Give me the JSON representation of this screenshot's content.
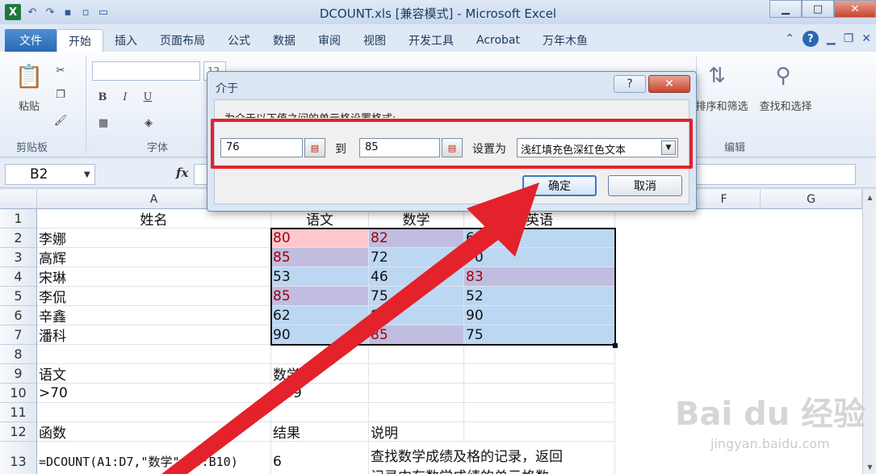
{
  "window": {
    "title": "DCOUNT.xls  [兼容模式]  -  Microsoft Excel",
    "minimize": "▁",
    "maximize": "□",
    "close": "✕"
  },
  "quick_access": {
    "logo": "X",
    "undo": "↶",
    "redo": "↷"
  },
  "ribbon_tabs": [
    {
      "label": "文件"
    },
    {
      "label": "开始"
    },
    {
      "label": "插入"
    },
    {
      "label": "页面布局"
    },
    {
      "label": "公式"
    },
    {
      "label": "数据"
    },
    {
      "label": "审阅"
    },
    {
      "label": "视图"
    },
    {
      "label": "开发工具"
    },
    {
      "label": "Acrobat"
    },
    {
      "label": "万年木鱼"
    }
  ],
  "ribbon": {
    "paste_label": "粘贴",
    "clipboard_label": "剪贴板",
    "font_label": "字体",
    "font_size": "12",
    "bold": "B",
    "italic": "I",
    "underline": "U",
    "sort_filter": "排序和筛选",
    "find_select": "查找和选择",
    "edit_label": "编辑"
  },
  "formula_bar": {
    "name_box": "B2",
    "fx": "fx"
  },
  "columns": [
    "A",
    "B",
    "C",
    "D",
    "E",
    "F",
    "G"
  ],
  "rows": [
    {
      "num": "1",
      "a": "姓名",
      "b": "语文",
      "c": "数学",
      "d": "英语"
    },
    {
      "num": "2",
      "a": "李娜",
      "b": "80",
      "c": "82",
      "d": "63"
    },
    {
      "num": "3",
      "a": "高辉",
      "b": "85",
      "c": "72",
      "d": "70"
    },
    {
      "num": "4",
      "a": "宋琳",
      "b": "53",
      "c": "46",
      "d": "83"
    },
    {
      "num": "5",
      "a": "李侃",
      "b": "85",
      "c": "75",
      "d": "52"
    },
    {
      "num": "6",
      "a": "辛鑫",
      "b": "62",
      "c": "86",
      "d": "90"
    },
    {
      "num": "7",
      "a": "潘科",
      "b": "90",
      "c": "85",
      "d": "75"
    },
    {
      "num": "8",
      "a": "",
      "b": "",
      "c": "",
      "d": ""
    },
    {
      "num": "9",
      "a": "语文",
      "b": "数学",
      "c": "",
      "d": ""
    },
    {
      "num": "10",
      "a": ">70",
      "b": ">59",
      "c": "",
      "d": ""
    },
    {
      "num": "11",
      "a": "",
      "b": "",
      "c": "",
      "d": ""
    },
    {
      "num": "12",
      "a": "函数",
      "b": "结果",
      "c": "说明",
      "d": ""
    },
    {
      "num": "13",
      "a": "=DCOUNT(A1:D7,\"数学\",B9:B10)",
      "b": "6",
      "c": "查找数学成绩及格的记录，返回",
      "d": ""
    }
  ],
  "row13_line2": "记录中有数学成绩的单元格数",
  "dialog": {
    "title": "介于",
    "help": "?",
    "close": "✕",
    "prompt": "为介于以下值之间的单元格设置格式:",
    "from_value": "76",
    "to_label": "到",
    "to_value": "85",
    "set_as_label": "设置为",
    "format_value": "浅红填充色深红色文本",
    "ok": "确定",
    "cancel": "取消"
  },
  "watermark": "Bai du 经验",
  "watermark_url": "jingyan.baidu.com",
  "colors": {
    "highlight_red": "#e3222b",
    "light_red_fill": "#ffc7ce",
    "dark_red_text": "#9c0006",
    "selection_blue": "#bcd7f2"
  }
}
